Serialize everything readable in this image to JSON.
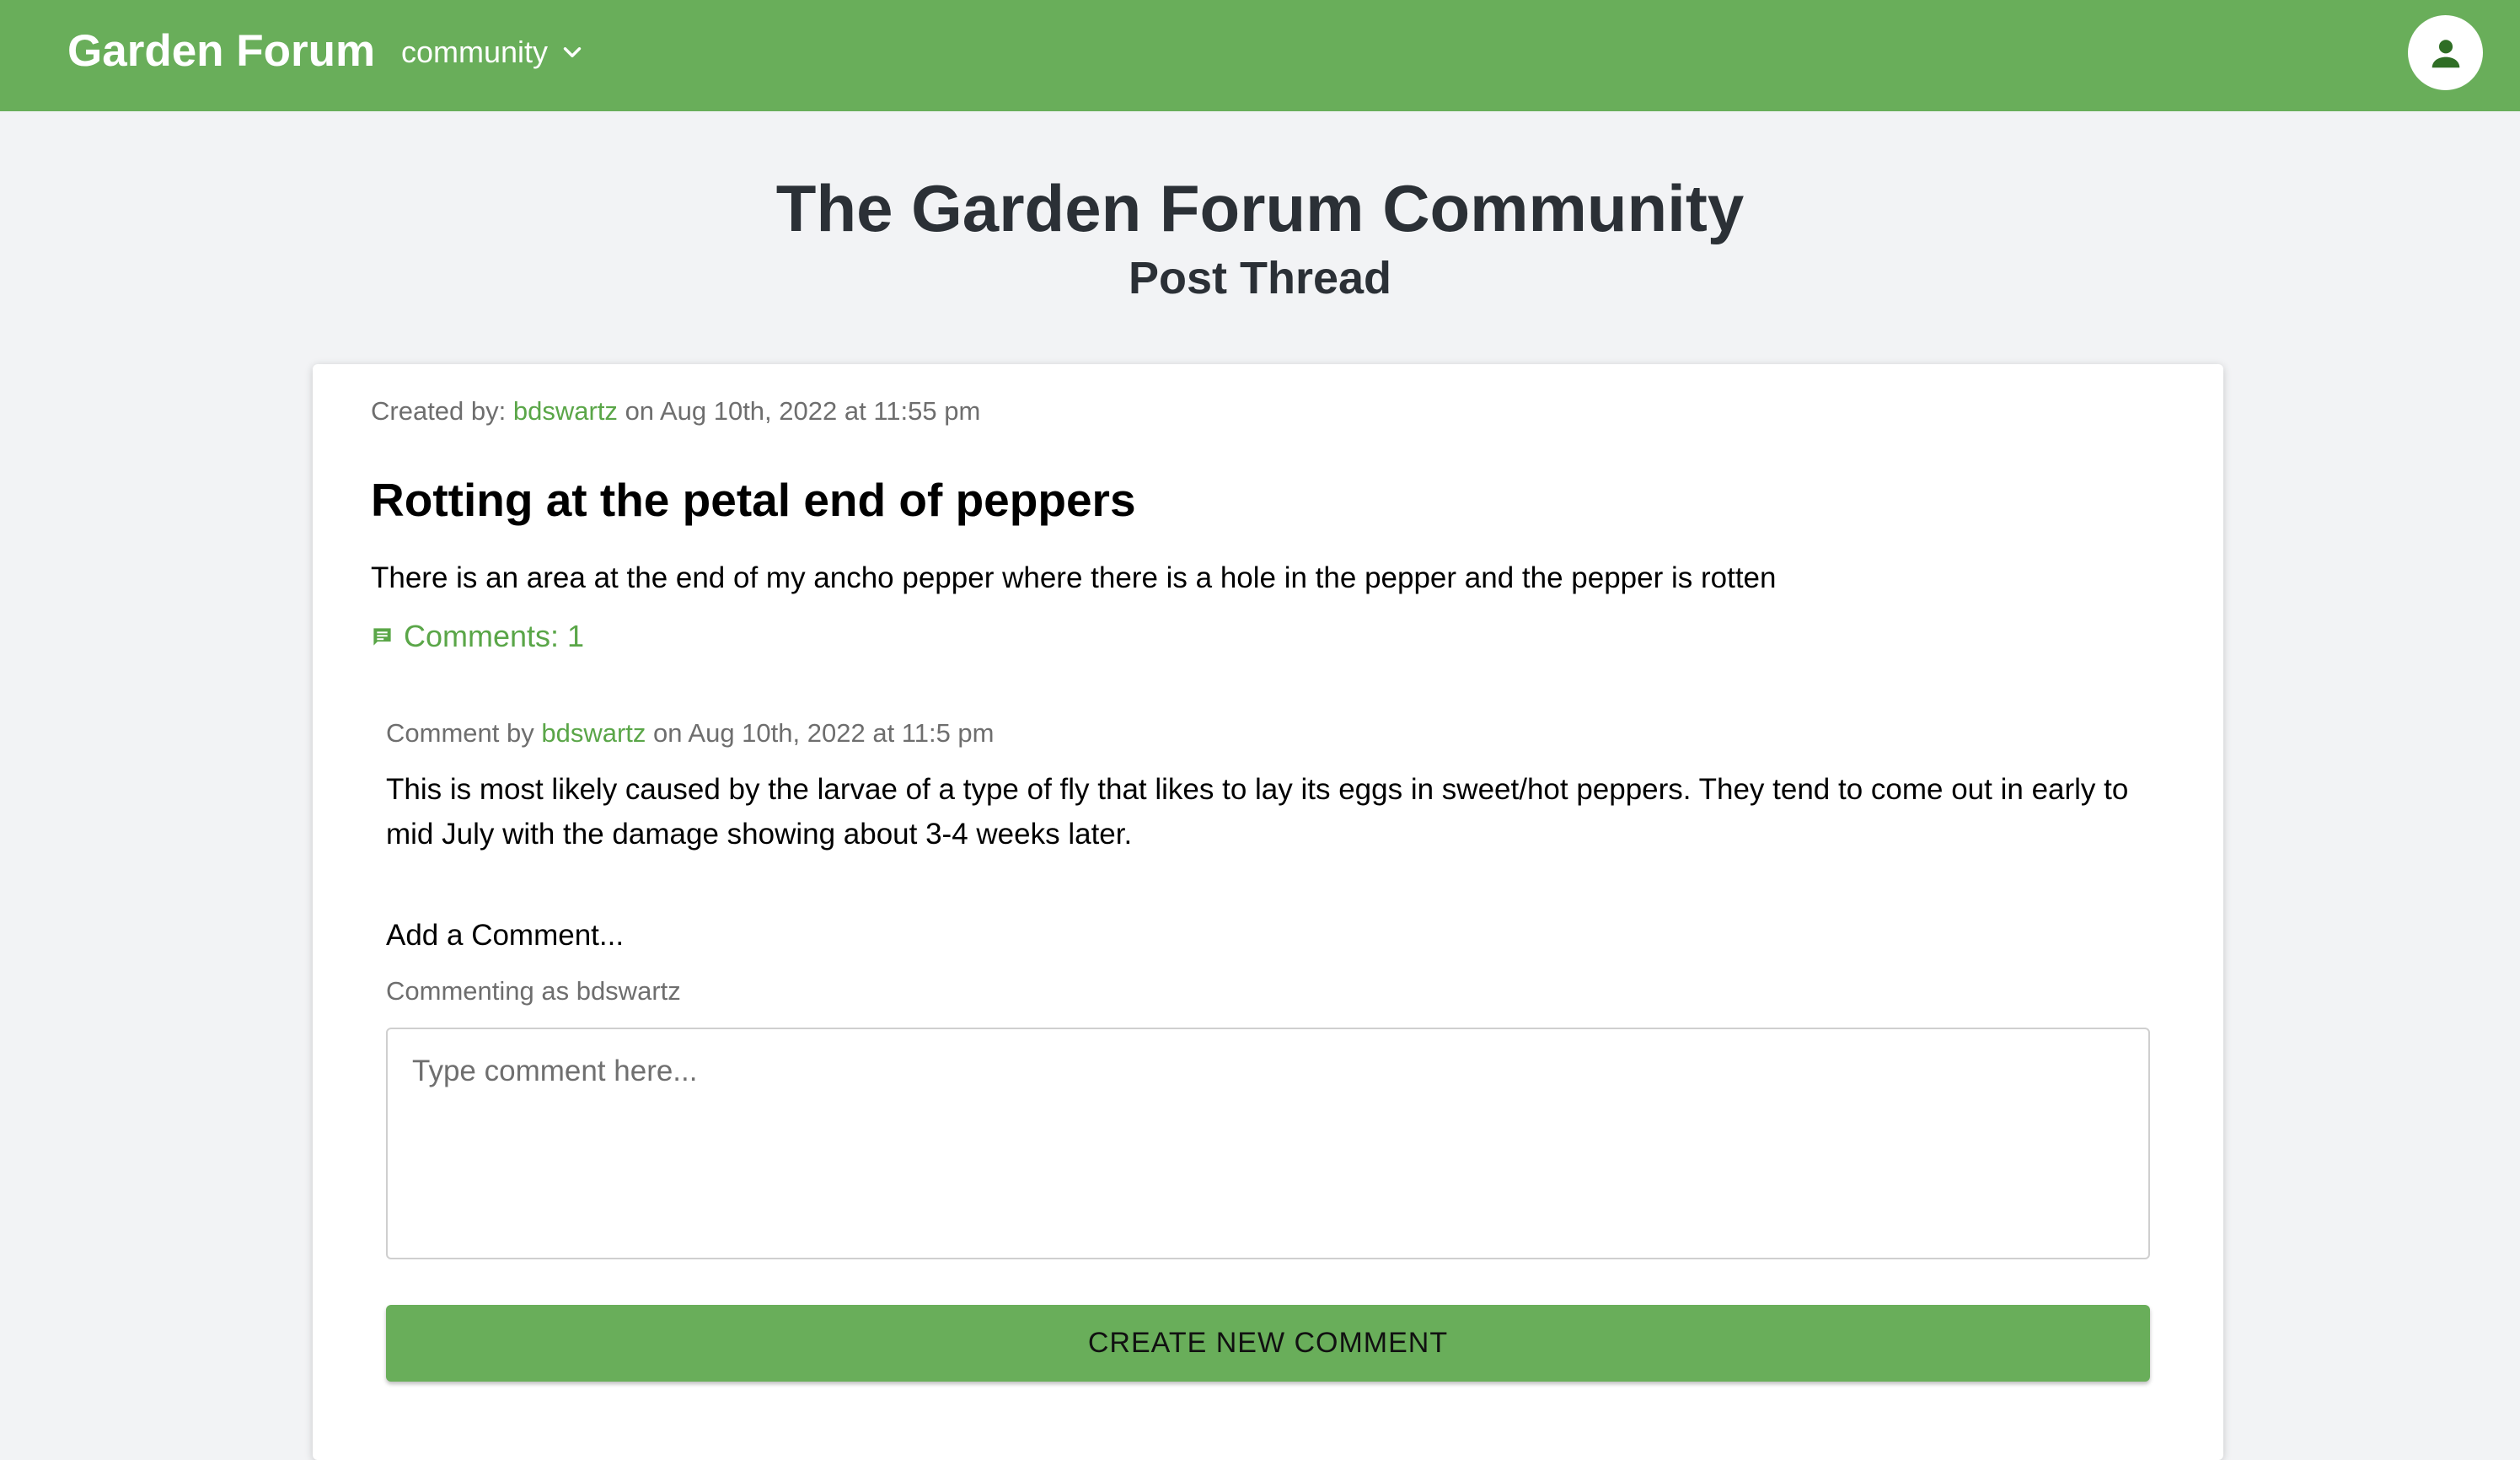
{
  "colors": {
    "brand_green": "#69ae5a",
    "link_green": "#5aa648",
    "background": "#f2f3f5",
    "title_text": "#2b3036"
  },
  "header": {
    "brand": "Garden Forum",
    "menu_label": "community",
    "menu_icon": "chevron-down-icon",
    "account_icon": "person-icon"
  },
  "page": {
    "title": "The Garden Forum Community",
    "subtitle": "Post Thread"
  },
  "post": {
    "created_prefix": "Created by:",
    "author": "bdswartz",
    "date_text": "on Aug 10th, 2022 at 11:55 pm",
    "title": "Rotting at the petal end of peppers",
    "body": "There is an area at the end of my ancho pepper where there is a hole in the pepper and the pepper is rotten",
    "comments_label": "Comments: 1",
    "comments_icon": "comment-icon"
  },
  "comments": [
    {
      "prefix": "Comment by",
      "author": "bdswartz",
      "date_text": "on Aug 10th, 2022 at 11:5 pm",
      "body": "This is most likely caused by the larvae of a type of fly that likes to lay its eggs in sweet/hot peppers. They tend to come out in early to mid July with the damage showing about 3-4 weeks later."
    }
  ],
  "add_comment": {
    "heading": "Add a Comment...",
    "commenting_as": "Commenting as bdswartz",
    "placeholder": "Type comment here...",
    "value": "",
    "button_label": "CREATE NEW COMMENT"
  }
}
